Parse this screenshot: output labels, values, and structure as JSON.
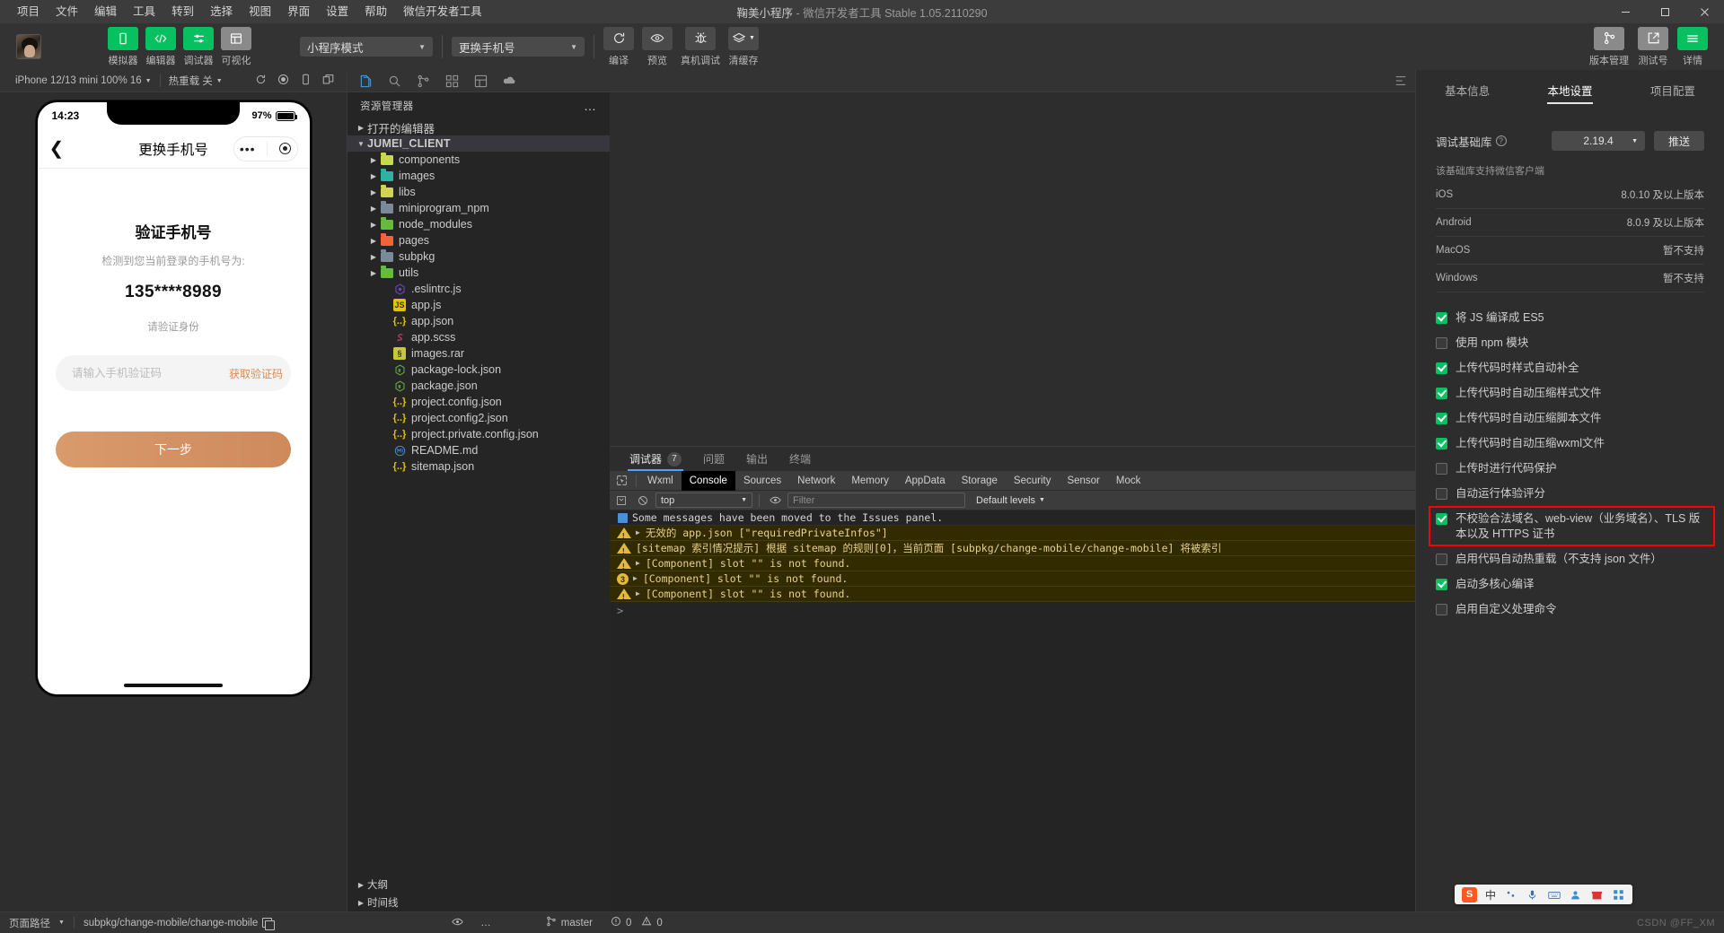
{
  "window": {
    "menus": [
      "项目",
      "文件",
      "编辑",
      "工具",
      "转到",
      "选择",
      "视图",
      "界面",
      "设置",
      "帮助",
      "微信开发者工具"
    ],
    "title_project": "鞠美小程序",
    "title_dash": "-",
    "title_app": "微信开发者工具 Stable 1.05.2110290",
    "controls": {
      "minimize": "minimize-icon",
      "maximize": "maximize-icon",
      "close": "close-icon"
    }
  },
  "toolbar": {
    "left_buttons": [
      {
        "label": "模拟器",
        "icon": "simulator-icon",
        "style": "green"
      },
      {
        "label": "编辑器",
        "icon": "code-icon",
        "style": "green"
      },
      {
        "label": "调试器",
        "icon": "debugger-icon",
        "style": "green"
      },
      {
        "label": "可视化",
        "icon": "visual-icon",
        "style": "grey"
      }
    ],
    "mode_select": "小程序模式",
    "page_select": "更换手机号",
    "mid_buttons": [
      {
        "label": "编译",
        "icon": "compile-icon"
      },
      {
        "label": "预览",
        "icon": "preview-icon"
      },
      {
        "label": "真机调试",
        "icon": "bug-icon"
      },
      {
        "label": "清缓存",
        "icon": "layers-icon"
      }
    ],
    "right_buttons": [
      {
        "label": "版本管理",
        "icon": "branch-icon",
        "style": "grey"
      },
      {
        "label": "测试号",
        "icon": "external-link-icon",
        "style": "grey"
      },
      {
        "label": "详情",
        "icon": "hamburger-icon",
        "style": "green"
      }
    ]
  },
  "simulator": {
    "device": "iPhone 12/13 mini 100% 16",
    "hot_reload": "热重载 关",
    "icons": [
      "refresh-icon",
      "record-icon",
      "rotate-device-icon",
      "multi-window-icon"
    ],
    "phone": {
      "time": "14:23",
      "battery": "97%",
      "nav_title": "更换手机号",
      "back": "back-chevron-icon",
      "capsule": {
        "more": "more-dots-icon",
        "target": "target-icon"
      },
      "heading": "验证手机号",
      "subtitle": "检测到您当前登录的手机号为:",
      "phone_number": "135****8989",
      "hint": "请验证身份",
      "code_placeholder": "请输入手机验证码",
      "code_value": "",
      "get_code_label": "获取验证码",
      "next_label": "下一步",
      "accent": "#d4905f"
    }
  },
  "explorer": {
    "icon_bar": [
      "files-icon",
      "search-icon",
      "source-control-icon",
      "extensions-icon",
      "layout-icon",
      "cloud-icon",
      "pin-icon"
    ],
    "header": "资源管理器",
    "header_more": "more-dots-icon",
    "open_editors": "打开的编辑器",
    "project_root": "JUMEI_CLIENT",
    "items": [
      {
        "label": "components",
        "kind": "folder",
        "color": "#c8d94a",
        "depth": 2,
        "arrow": true
      },
      {
        "label": "images",
        "kind": "folder",
        "color": "#2bb5a0",
        "depth": 2,
        "arrow": true
      },
      {
        "label": "libs",
        "kind": "folder",
        "color": "#d0d44f",
        "depth": 2,
        "arrow": true
      },
      {
        "label": "miniprogram_npm",
        "kind": "folder",
        "color": "#7b8a99",
        "depth": 2,
        "arrow": true
      },
      {
        "label": "node_modules",
        "kind": "folder",
        "color": "#66bb3f",
        "depth": 2,
        "arrow": true
      },
      {
        "label": "pages",
        "kind": "folder",
        "color": "#f4623a",
        "depth": 2,
        "arrow": true
      },
      {
        "label": "subpkg",
        "kind": "folder",
        "color": "#7b8a99",
        "depth": 2,
        "arrow": true
      },
      {
        "label": "utils",
        "kind": "folder",
        "color": "#66bb3f",
        "depth": 2,
        "arrow": true
      },
      {
        "label": ".eslintrc.js",
        "kind": "eslint",
        "color": "#6a4bbc",
        "depth": 3,
        "arrow": false
      },
      {
        "label": "app.js",
        "kind": "js",
        "color": "#e6c100",
        "depth": 3,
        "arrow": false
      },
      {
        "label": "app.json",
        "kind": "json",
        "color": "#e6c100",
        "depth": 3,
        "arrow": false
      },
      {
        "label": "app.scss",
        "kind": "scss",
        "color": "#d6356f",
        "depth": 3,
        "arrow": false
      },
      {
        "label": "images.rar",
        "kind": "rar",
        "color": "#c8c840",
        "depth": 3,
        "arrow": false
      },
      {
        "label": "package-lock.json",
        "kind": "node",
        "color": "#6cb644",
        "depth": 3,
        "arrow": false
      },
      {
        "label": "package.json",
        "kind": "node",
        "color": "#6cb644",
        "depth": 3,
        "arrow": false
      },
      {
        "label": "project.config.json",
        "kind": "json",
        "color": "#e6c100",
        "depth": 3,
        "arrow": false
      },
      {
        "label": "project.config2.json",
        "kind": "json",
        "color": "#e6c100",
        "depth": 3,
        "arrow": false
      },
      {
        "label": "project.private.config.json",
        "kind": "json",
        "color": "#e6c100",
        "depth": 3,
        "arrow": false
      },
      {
        "label": "README.md",
        "kind": "md",
        "color": "#4a90d9",
        "depth": 3,
        "arrow": false
      },
      {
        "label": "sitemap.json",
        "kind": "json",
        "color": "#e6c100",
        "depth": 3,
        "arrow": false
      }
    ],
    "footer": [
      "大纲",
      "时间线"
    ]
  },
  "devtools": {
    "tabs": [
      {
        "label": "调试器",
        "badge": "7",
        "active": true
      },
      {
        "label": "问题",
        "badge": "",
        "active": false
      },
      {
        "label": "输出",
        "badge": "",
        "active": false
      },
      {
        "label": "终端",
        "badge": "",
        "active": false
      }
    ],
    "panel_tabs": [
      "Wxml",
      "Console",
      "Sources",
      "Network",
      "Memory",
      "AppData",
      "Storage",
      "Security",
      "Sensor",
      "Mock"
    ],
    "panel_active": "Console",
    "picker_icon": "inspect-icon",
    "filter": {
      "clear_icon": "no-entry-icon",
      "context": "top",
      "eye_icon": "eye-icon",
      "placeholder": "Filter",
      "value": "",
      "levels": "Default levels"
    },
    "messages": [
      {
        "type": "info",
        "icon": "blue-square",
        "arrow": false,
        "text": "Some messages have been moved to the Issues panel."
      },
      {
        "type": "warn",
        "icon": "triangle",
        "arrow": true,
        "text": "无效的 app.json [\"requiredPrivateInfos\"]"
      },
      {
        "type": "warn",
        "icon": "triangle",
        "arrow": false,
        "text": "[sitemap 索引情况提示] 根据 sitemap 的规则[0]，当前页面 [subpkg/change-mobile/change-mobile] 将被索引"
      },
      {
        "type": "warn",
        "icon": "triangle",
        "arrow": true,
        "text": "[Component] slot \"\" is not found."
      },
      {
        "type": "warn",
        "icon": "count",
        "count": "3",
        "arrow": true,
        "text": "[Component] slot \"\" is not found."
      },
      {
        "type": "warn",
        "icon": "triangle",
        "arrow": true,
        "text": "[Component] slot \"\" is not found."
      }
    ],
    "prompt": ">"
  },
  "settings": {
    "tabs": [
      {
        "label": "基本信息",
        "active": false
      },
      {
        "label": "本地设置",
        "active": true
      },
      {
        "label": "项目配置",
        "active": false
      }
    ],
    "debug_lib_label": "调试基础库",
    "debug_lib_help": "?",
    "debug_lib_version": "2.19.4",
    "push_label": "推送",
    "support_note": "该基础库支持微信客户端",
    "support_rows": [
      {
        "k": "iOS",
        "v": "8.0.10 及以上版本"
      },
      {
        "k": "Android",
        "v": "8.0.9 及以上版本"
      },
      {
        "k": "MacOS",
        "v": "暂不支持"
      },
      {
        "k": "Windows",
        "v": "暂不支持"
      }
    ],
    "checkboxes": [
      {
        "label": "将 JS 编译成 ES5",
        "checked": true,
        "highlight": false
      },
      {
        "label": "使用 npm 模块",
        "checked": false,
        "highlight": false
      },
      {
        "label": "上传代码时样式自动补全",
        "checked": true,
        "highlight": false
      },
      {
        "label": "上传代码时自动压缩样式文件",
        "checked": true,
        "highlight": false
      },
      {
        "label": "上传代码时自动压缩脚本文件",
        "checked": true,
        "highlight": false
      },
      {
        "label": "上传代码时自动压缩wxml文件",
        "checked": true,
        "highlight": false
      },
      {
        "label": "上传时进行代码保护",
        "checked": false,
        "highlight": false
      },
      {
        "label": "自动运行体验评分",
        "checked": false,
        "highlight": false
      },
      {
        "label": "不校验合法域名、web-view（业务域名）、TLS 版本以及 HTTPS 证书",
        "checked": true,
        "highlight": true
      },
      {
        "label": "启用代码自动热重载（不支持 json 文件）",
        "checked": false,
        "highlight": false
      },
      {
        "label": "启动多核心编译",
        "checked": true,
        "highlight": false
      },
      {
        "label": "启用自定义处理命令",
        "checked": false,
        "highlight": false
      }
    ],
    "highlight_color": "#ff0000"
  },
  "ime": {
    "logo": "S",
    "mode": "中",
    "items": [
      "punctuation-icon",
      "mic-icon",
      "keyboard-icon",
      "user-icon",
      "gift-icon",
      "grid-icon"
    ]
  },
  "watermark": "CSDN @FF_XM",
  "statusbar": {
    "path_label": "页面路径",
    "path_value": "subpkg/change-mobile/change-mobile",
    "copy_icon": "copy-icon",
    "eye_icon": "eye-icon",
    "more_icon": "more-dots-icon",
    "branch": "master",
    "branch_icon": "branch-icon",
    "errors": "0",
    "warnings": "0",
    "error_icon": "error-circle-icon",
    "warning_icon": "warning-triangle-icon"
  }
}
